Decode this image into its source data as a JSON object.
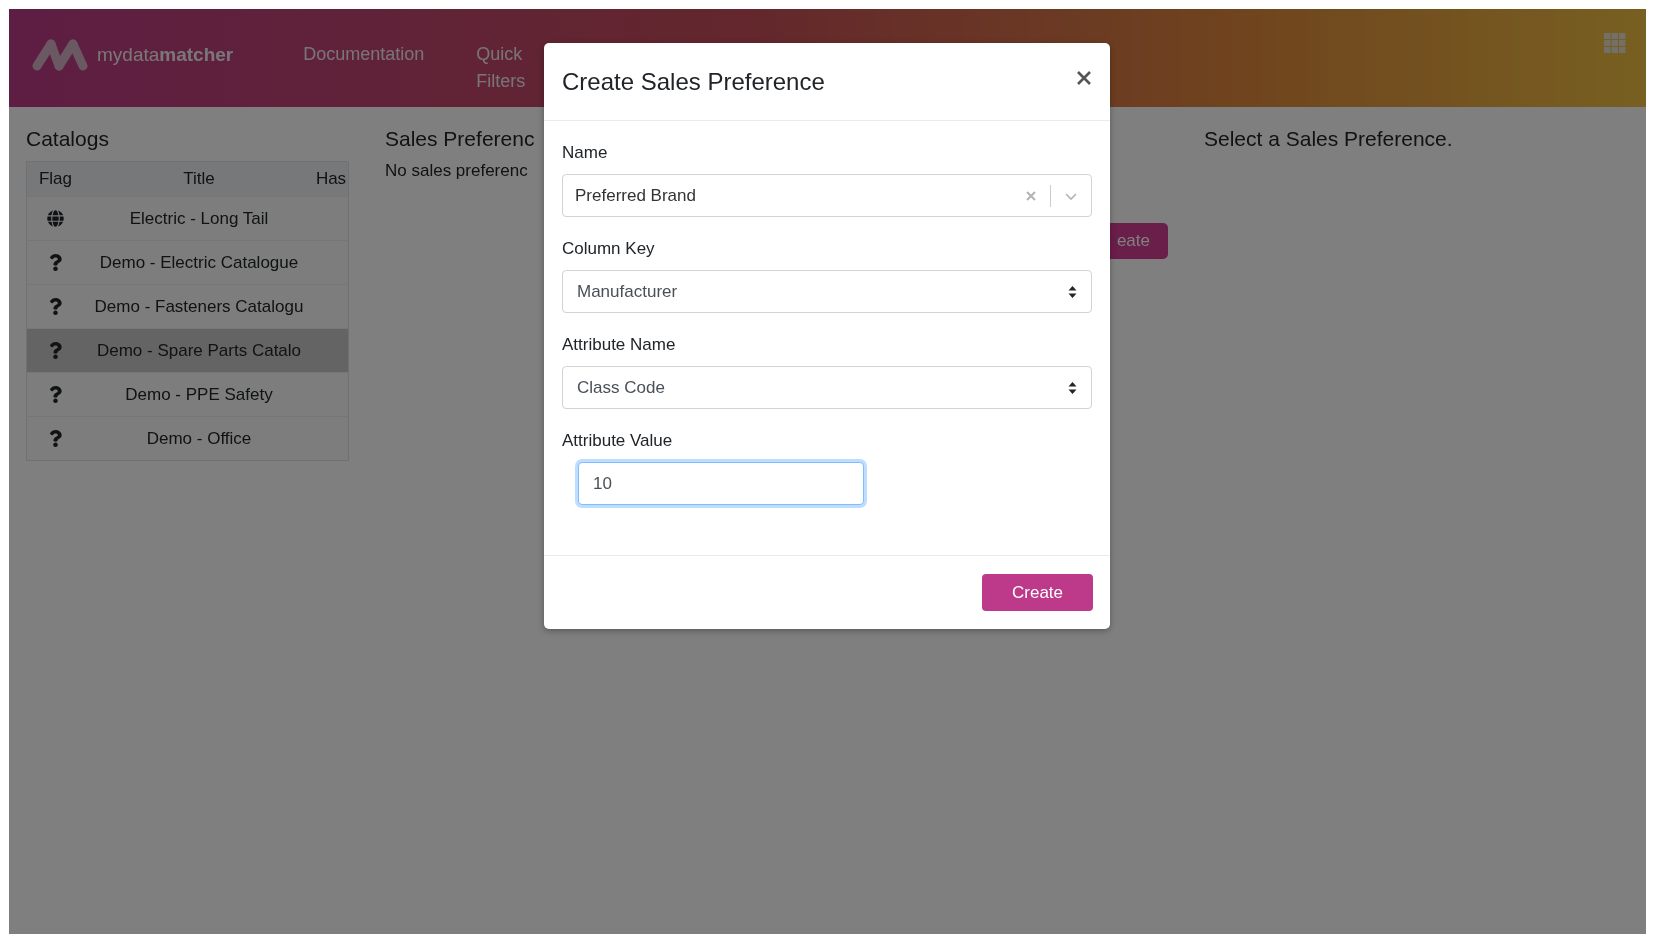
{
  "header": {
    "logo_text": "mydata**matcher**",
    "nav": [
      {
        "label": "Documentation"
      },
      {
        "label": "Quick Filters"
      }
    ]
  },
  "catalogs": {
    "title": "Catalogs",
    "columns": [
      "Flag",
      "Title",
      "Has"
    ],
    "rows": [
      {
        "kind": "globe",
        "title": "Electric - Long Tail",
        "selected": false
      },
      {
        "kind": "question",
        "title": "Demo - Electric Catalogue",
        "selected": false
      },
      {
        "kind": "question",
        "title": "Demo - Fasteners Catalogu",
        "selected": false
      },
      {
        "kind": "question",
        "title": "Demo - Spare Parts Catalo",
        "selected": true
      },
      {
        "kind": "question",
        "title": "Demo - PPE Safety",
        "selected": false
      },
      {
        "kind": "question",
        "title": "Demo - Office",
        "selected": false
      }
    ]
  },
  "sales_preferences": {
    "title": "Sales Preferenc",
    "empty_text": "No sales preferenc",
    "create_button": "eate"
  },
  "detail": {
    "message": "Select a Sales Preference."
  },
  "modal": {
    "title": "Create Sales Preference",
    "fields": [
      {
        "kind": "combobox",
        "label": "Name",
        "value": "Preferred Brand",
        "focused": false
      },
      {
        "kind": "select",
        "label": "Column Key",
        "value": "Manufacturer",
        "focused": false
      },
      {
        "kind": "select",
        "label": "Attribute Name",
        "value": "Class Code",
        "focused": false
      },
      {
        "kind": "input",
        "label": "Attribute Value",
        "value": "10",
        "focused": true
      }
    ],
    "submit": "Create"
  }
}
